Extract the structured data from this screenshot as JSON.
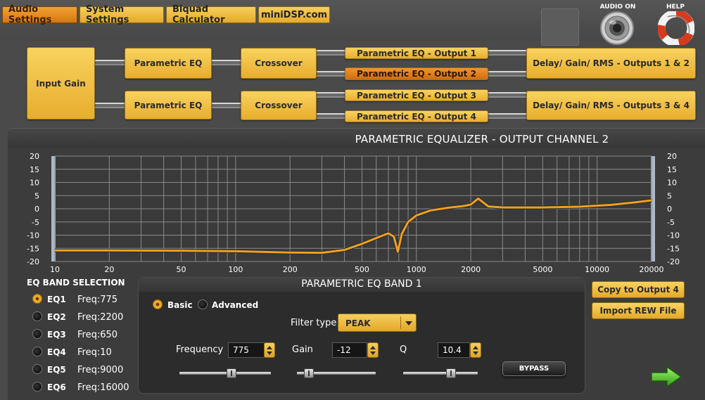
{
  "tabs": [
    {
      "label": "Audio Settings",
      "active": true
    },
    {
      "label": "System Settings",
      "active": false
    },
    {
      "label": "Biquad Calculator",
      "active": false
    },
    {
      "label": "miniDSP.com",
      "active": false
    }
  ],
  "top_controls": {
    "audio_label": "AUDIO ON",
    "help_label": "HELP",
    "audio_icon": "speaker-icon",
    "help_icon": "lifebuoy-icon"
  },
  "routing": {
    "input_gain": "Input Gain",
    "peq_1": "Parametric EQ",
    "peq_2": "Parametric EQ",
    "xover_1": "Crossover",
    "xover_2": "Crossover",
    "out_1": "Parametric EQ - Output 1",
    "out_2": "Parametric EQ - Output 2",
    "out_3": "Parametric EQ - Output 3",
    "out_4": "Parametric EQ - Output 4",
    "delay_12": "Delay/ Gain/ RMS - Outputs 1 & 2",
    "delay_34": "Delay/ Gain/ RMS - Outputs 3 & 4",
    "selected": "out_2"
  },
  "panel": {
    "title": "PARAMETRIC EQUALIZER - OUTPUT CHANNEL 2"
  },
  "chart_data": {
    "type": "line",
    "x_scale": "log",
    "xlim": [
      10,
      20000
    ],
    "ylim": [
      -20,
      20
    ],
    "grid": true,
    "x_tick_labels": [
      "10",
      "20",
      "50",
      "100",
      "200",
      "500",
      "1000",
      "2000",
      "5000",
      "10000",
      "20000"
    ],
    "y_tick_labels": [
      "20",
      "15",
      "10",
      "5",
      "0",
      "-5",
      "-10",
      "-15",
      "-20"
    ],
    "series": [
      {
        "color": "#f0a020",
        "x": [
          10,
          20,
          50,
          100,
          200,
          300,
          400,
          500,
          600,
          700,
          750,
          790,
          830,
          900,
          1000,
          1200,
          1500,
          1800,
          2000,
          2200,
          2500,
          3000,
          5000,
          8000,
          12000,
          16000,
          20000
        ],
        "y": [
          -15.8,
          -15.8,
          -15.9,
          -16.1,
          -16.6,
          -16.7,
          -15.6,
          -13.3,
          -11.1,
          -9.3,
          -10.5,
          -16.3,
          -9.6,
          -5.0,
          -2.5,
          -0.6,
          0.4,
          1.0,
          1.6,
          3.9,
          0.9,
          0.5,
          0.5,
          0.8,
          1.5,
          2.4,
          3.2
        ]
      }
    ]
  },
  "band_selection": {
    "title": "EQ BAND SELECTION",
    "bands": [
      {
        "name": "EQ1",
        "freq": "Freq:775",
        "selected": true
      },
      {
        "name": "EQ2",
        "freq": "Freq:2200",
        "selected": false
      },
      {
        "name": "EQ3",
        "freq": "Freq:650",
        "selected": false
      },
      {
        "name": "EQ4",
        "freq": "Freq:10",
        "selected": false
      },
      {
        "name": "EQ5",
        "freq": "Freq:9000",
        "selected": false
      },
      {
        "name": "EQ6",
        "freq": "Freq:16000",
        "selected": false
      }
    ]
  },
  "band_panel": {
    "title": "PARAMETRIC EQ BAND 1",
    "mode_basic": "Basic",
    "mode_advanced": "Advanced",
    "mode_selected": "basic",
    "filter_type_label": "Filter type",
    "filter_type_value": "PEAK",
    "frequency_label": "Frequency",
    "frequency_value": "775",
    "gain_label": "Gain",
    "gain_value": "-12",
    "q_label": "Q",
    "q_value": "10.4",
    "frequency_slider": 0.58,
    "gain_slider": 0.1,
    "q_slider": 0.66,
    "bypass_label": "BYPASS"
  },
  "actions": {
    "copy_label": "Copy to Output 4",
    "import_label": "Import REW File",
    "next_icon": "arrow-right-icon"
  }
}
